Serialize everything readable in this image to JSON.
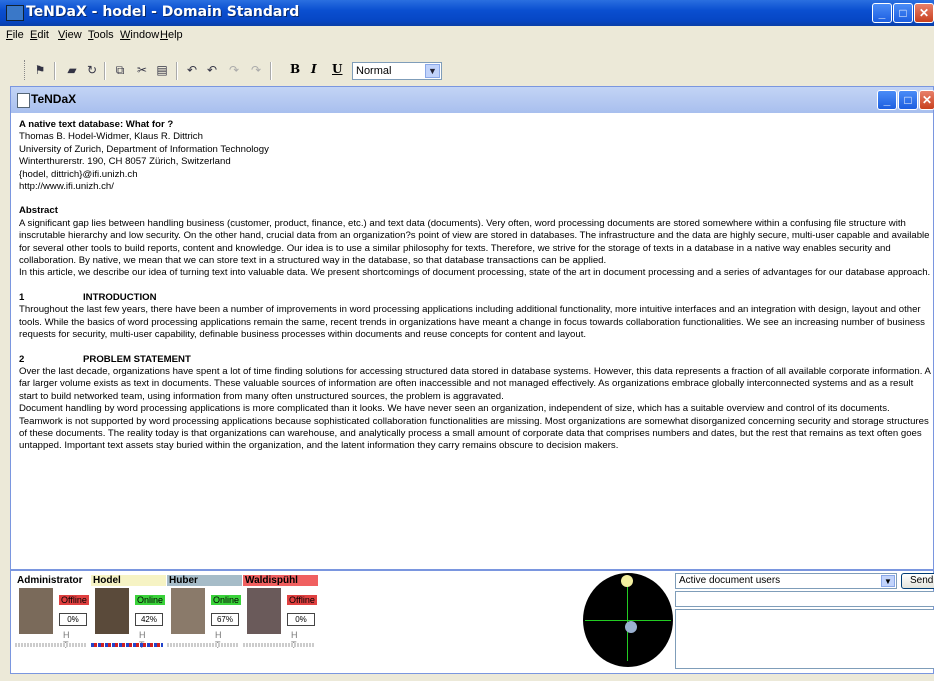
{
  "window": {
    "title": "TeNDaX - hodel - Domain Standard"
  },
  "menu": [
    "File",
    "Edit",
    "View",
    "Tools",
    "Window",
    "Help"
  ],
  "toolbar": {
    "bold": "B",
    "italic": "I",
    "underline": "U",
    "style_value": "Normal"
  },
  "child_window": {
    "title": "TeNDaX"
  },
  "document": {
    "title": "A native text database: What for ?",
    "authors": "Thomas B. Hodel-Widmer, Klaus R. Dittrich",
    "affiliation": "University of Zurich, Department of Information Technology",
    "address": "Winterthurerstr. 190, CH 8057 Zürich, Switzerland",
    "email": "{hodel, dittrich}@ifi.unizh.ch",
    "url": "http://www.ifi.unizh.ch/",
    "abstract_heading": "Abstract",
    "abstract_p1": "A significant gap lies between handling business (customer, product, finance, etc.) and text data (documents). Very often, word processing documents are stored somewhere within a confusing file structure with inscrutable hierarchy and low security. On the other hand, crucial data from an organization?s point of view are stored in databases. The infrastructure and the data are highly secure, multi-user capable and available for several other tools to build reports, content and knowledge. Our idea is to use a similar philosophy for texts. Therefore, we strive for the storage of texts in a database in a native way enables security and collaboration. By native, we mean that we can store text in a structured way in the database, so that database transactions can be applied.",
    "abstract_p2": "In this article, we describe our idea of turning text into valuable data. We present shortcomings of document processing, state of the art in document processing and a series of advantages for our database approach.",
    "sec1_num": "1",
    "sec1_title": "INTRODUCTION",
    "sec1_p1": "Throughout the last few years, there have been a number of improvements in word processing applications including additional functionality, more intuitive interfaces and an integration with design, layout and other tools. While the basics of word processing applications remain the same, recent trends in organizations have meant a change in focus towards collaboration functionalities. We see an increasing number of business requests for security, multi-user capability, definable business processes within documents and reuse concepts for content and layout.",
    "sec2_num": "2",
    "sec2_title": "PROBLEM STATEMENT",
    "sec2_p1": "Over the last decade, organizations have spent a lot of time finding solutions for accessing structured data stored in database systems. However, this data represents a fraction of all available corporate information. A far larger volume exists as text in documents. These valuable sources of information are often inaccessible and not managed effectively. As organizations embrace globally interconnected systems and as a result start to build networked team, using information from many often unstructured sources, the problem is aggravated.",
    "sec2_p2": "Document handling by word processing applications is more complicated than it looks. We have never seen an organization, independent of size, which has a suitable overview and control of its documents. Teamwork is not supported by word processing applications because sophisticated collaboration functionalities are missing. Most organizations are somewhat disorganized concerning security and storage structures of these documents. The reality today is that organizations can warehouse, and analytically process a small amount of corporate data that comprises numbers and dates, but the rest that remains as text often goes untapped. Important text assets stay buried within the organization, and the latent information they carry remains obscure to decision makers."
  },
  "users": [
    {
      "name": "Administrator",
      "status": "Offline",
      "percent": "0%",
      "ht": "H T",
      "name_bg": "#ffffff",
      "status_color": "#e04040",
      "photo_bg": "#7a6a5a"
    },
    {
      "name": "Hodel",
      "status": "Online",
      "percent": "42%",
      "ht": "H T",
      "name_bg": "#f6f3c4",
      "status_color": "#3ad23a",
      "photo_bg": "#5a4a3a"
    },
    {
      "name": "Huber",
      "status": "Online",
      "percent": "67%",
      "ht": "H T",
      "name_bg": "#a6bcc8",
      "status_color": "#3ad23a",
      "photo_bg": "#8a7a6a"
    },
    {
      "name": "Waldispühl",
      "status": "Offline",
      "percent": "0%",
      "ht": "H T",
      "name_bg": "#f06060",
      "status_color": "#e04040",
      "photo_bg": "#6a5a5a"
    }
  ],
  "chat": {
    "channel": "Active document users",
    "send_label": "Send"
  }
}
